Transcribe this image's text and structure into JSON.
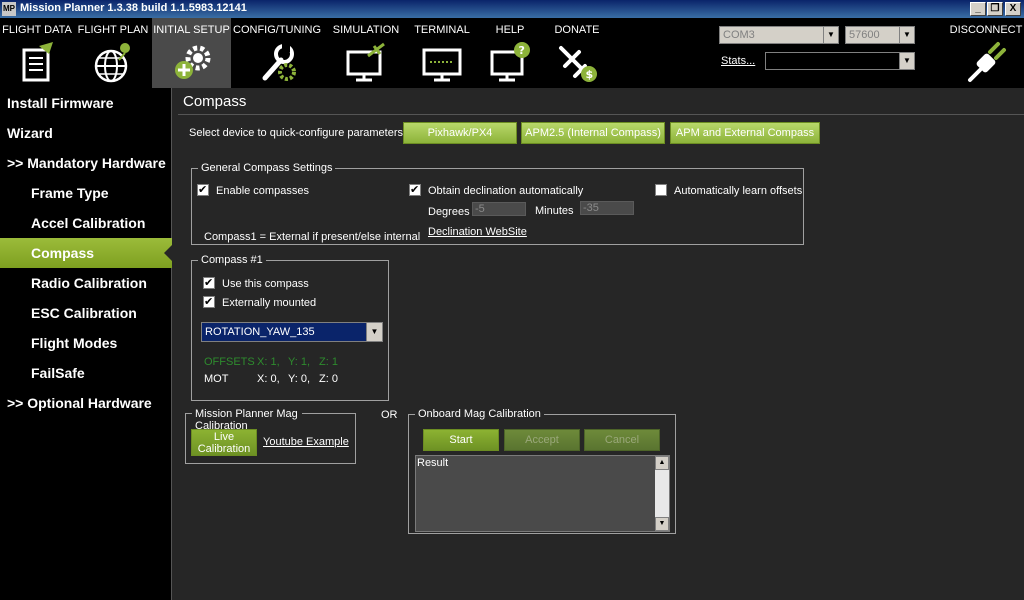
{
  "window": {
    "title": "Mission Planner 1.3.38 build 1.1.5983.12141",
    "app_icon": "MP",
    "min": "_",
    "max": "❐",
    "close": "X"
  },
  "menu": {
    "flight_data": "FLIGHT DATA",
    "flight_plan": "FLIGHT PLAN",
    "initial_setup": "INITIAL SETUP",
    "config_tuning": "CONFIG/TUNING",
    "simulation": "SIMULATION",
    "terminal": "TERMINAL",
    "help": "HELP",
    "donate": "DONATE",
    "disconnect": "DISCONNECT"
  },
  "connection": {
    "port": "COM3",
    "baud": "57600",
    "stats_label": "Stats...",
    "stats_value": ""
  },
  "sidebar": {
    "install_firmware": "Install Firmware",
    "wizard": "Wizard",
    "mandatory_hardware": ">> Mandatory Hardware",
    "frame_type": "Frame Type",
    "accel_calibration": "Accel Calibration",
    "compass": "Compass",
    "radio_calibration": "Radio Calibration",
    "esc_calibration": "ESC Calibration",
    "flight_modes": "Flight Modes",
    "failsafe": "FailSafe",
    "optional_hardware": ">> Optional Hardware"
  },
  "page": {
    "title": "Compass",
    "quick_config_label": "Select device to quick-configure parameters:",
    "btn_pixhawk": "Pixhawk/PX4",
    "btn_apm25": "APM2.5 (Internal Compass)",
    "btn_apm_ext": "APM and External Compass"
  },
  "general": {
    "title": "General Compass Settings",
    "enable_compasses": "Enable compasses",
    "obtain_declination": "Obtain declination automatically",
    "auto_learn": "Automatically learn offsets",
    "degrees_label": "Degrees",
    "degrees_value": "-5",
    "minutes_label": "Minutes",
    "minutes_value": "-35",
    "compass1_note": "Compass1 = External if present/else internal",
    "declination_link": "Declination WebSite"
  },
  "compass1": {
    "title": "Compass #1",
    "use_this": "Use this compass",
    "externally_mounted": "Externally mounted",
    "rotation": "ROTATION_YAW_135",
    "offsets_label": "OFFSETS",
    "offsets_x": "X: 1,",
    "offsets_y": "Y: 1,",
    "offsets_z": "Z: 1",
    "mot_label": "MOT",
    "mot_x": "X: 0,",
    "mot_y": "Y: 0,",
    "mot_z": "Z: 0"
  },
  "mp_mag": {
    "title": "Mission Planner Mag Calibration",
    "live_button": "Live Calibration",
    "youtube_link": "Youtube Example"
  },
  "or_label": "OR",
  "onboard": {
    "title": "Onboard Mag Calibration",
    "start": "Start",
    "accept": "Accept",
    "cancel": "Cancel",
    "result_label": "Result"
  },
  "colors": {
    "accent_green": "#8db33a",
    "offsets_green": "#2e8b2e",
    "background": "#262626"
  }
}
